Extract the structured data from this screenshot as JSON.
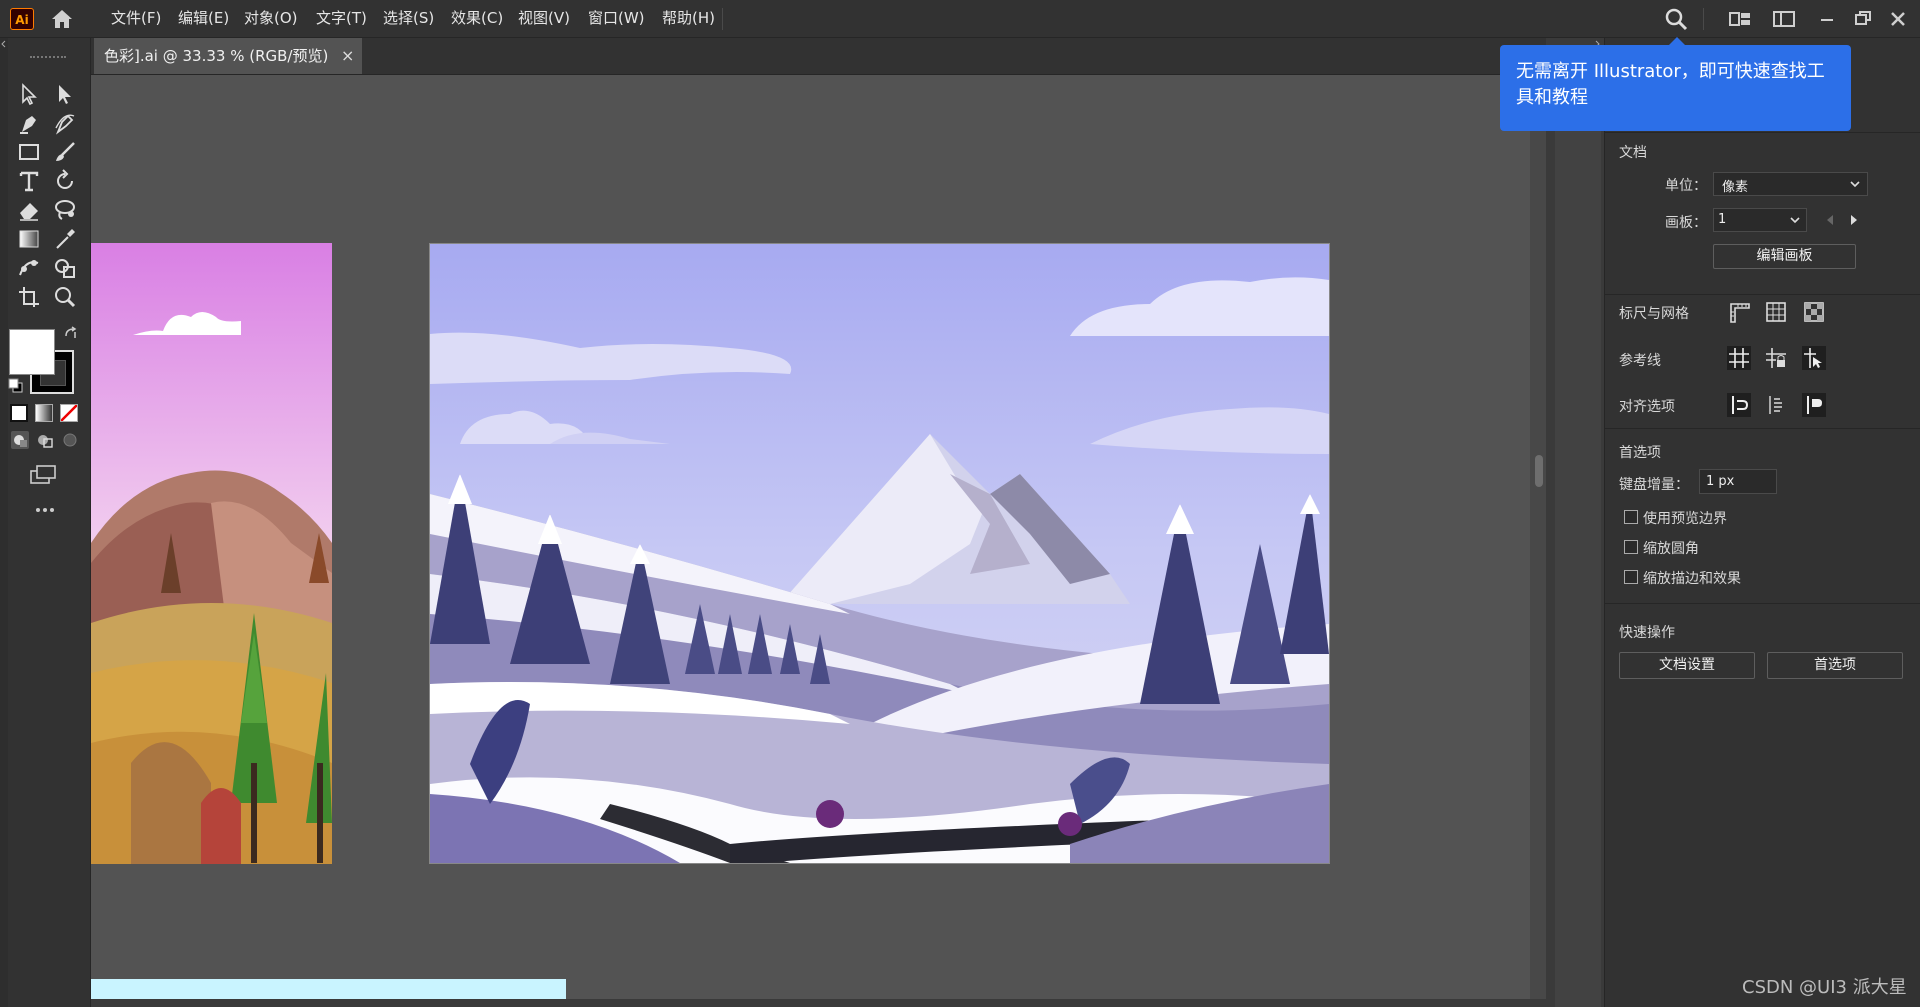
{
  "menubar": {
    "app_logo": "Ai",
    "items": [
      {
        "label": "文件(F)"
      },
      {
        "label": "编辑(E)"
      },
      {
        "label": "对象(O)"
      },
      {
        "label": "文字(T)"
      },
      {
        "label": "选择(S)"
      },
      {
        "label": "效果(C)"
      },
      {
        "label": "视图(V)"
      },
      {
        "label": "窗口(W)"
      },
      {
        "label": "帮助(H)"
      }
    ]
  },
  "document": {
    "tab_title": "色彩].ai @ 33.33 % (RGB/预览)",
    "close_glyph": "×"
  },
  "tooltip": {
    "text": "无需离开 Illustrator，即可快速查找工具和教程"
  },
  "properties": {
    "document_section": "文档",
    "units_label": "单位：",
    "units_value": "像素",
    "artboard_label": "画板：",
    "artboard_value": "1",
    "edit_artboard_button": "编辑画板",
    "rulers_grid_label": "标尺与网格",
    "guides_label": "参考线",
    "align_options_label": "对齐选项",
    "preferences_section": "首选项",
    "keyboard_increment_label": "键盘增量：",
    "keyboard_increment_value": "1 px",
    "use_preview_bounds": "使用预览边界",
    "scale_corners": "缩放圆角",
    "scale_strokes_effects": "缩放描边和效果",
    "quick_actions_section": "快速操作",
    "document_setup_button": "文档设置",
    "preferences_button": "首选项"
  },
  "watermark": "CSDN @UI3 派大星",
  "colors": {
    "accent": "#2c6fe8",
    "ui_dark": "#323232",
    "canvas": "#535353",
    "fill_swatch": "#ffffff",
    "stroke_swatch": "#000000"
  }
}
